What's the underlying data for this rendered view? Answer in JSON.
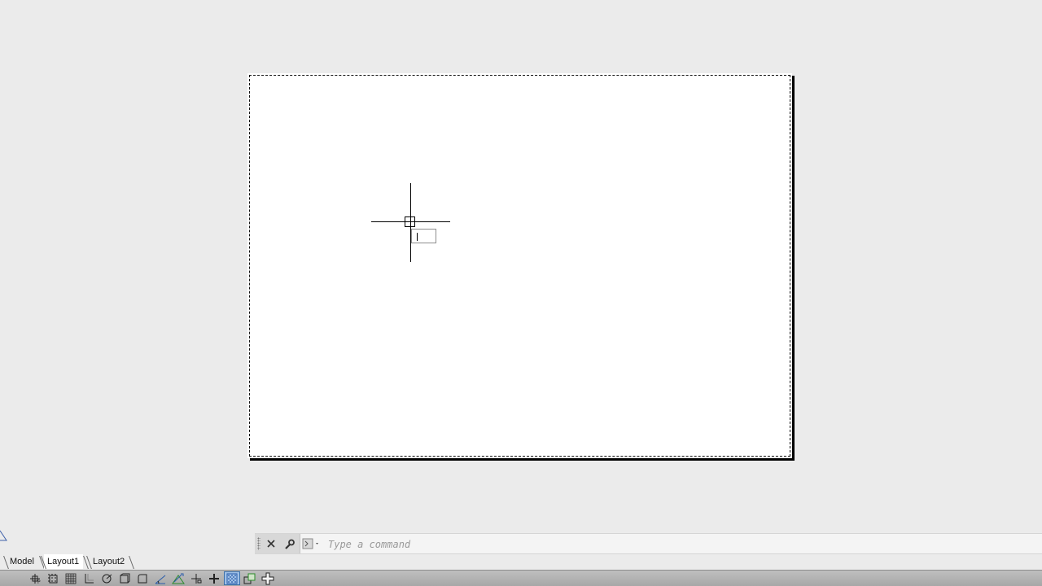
{
  "command_line": {
    "placeholder": "Type a command",
    "close_icon": "close-icon",
    "customize_icon": "wrench-icon",
    "prompt_icon": "command-prompt-icon"
  },
  "tabs": [
    {
      "label": "Model",
      "active": false
    },
    {
      "label": "Layout1",
      "active": true
    },
    {
      "label": "Layout2",
      "active": false
    }
  ],
  "status_bar": {
    "buttons": [
      {
        "icon": "model-space-icon",
        "on": false
      },
      {
        "icon": "snap-mode-icon",
        "on": false
      },
      {
        "icon": "grid-display-icon",
        "on": false
      },
      {
        "icon": "ortho-mode-icon",
        "on": false
      },
      {
        "icon": "polar-tracking-icon",
        "on": false
      },
      {
        "icon": "object-snap-3d-icon",
        "on": false
      },
      {
        "icon": "object-snap-icon",
        "on": false
      },
      {
        "icon": "object-snap-tracking-icon",
        "on": false
      },
      {
        "icon": "dynamic-ucs-icon",
        "on": false
      },
      {
        "icon": "dynamic-input-icon",
        "on": false
      },
      {
        "icon": "lineweight-icon",
        "on": false
      },
      {
        "icon": "transparency-icon",
        "on": true
      },
      {
        "icon": "selection-cycling-icon",
        "on": false
      },
      {
        "icon": "annotation-monitor-icon",
        "on": false
      }
    ]
  },
  "colors": {
    "background": "#ebebeb",
    "paper": "#ffffff",
    "status_bar": "#b3b3b3",
    "active_toggle": "#9fc0e6"
  }
}
